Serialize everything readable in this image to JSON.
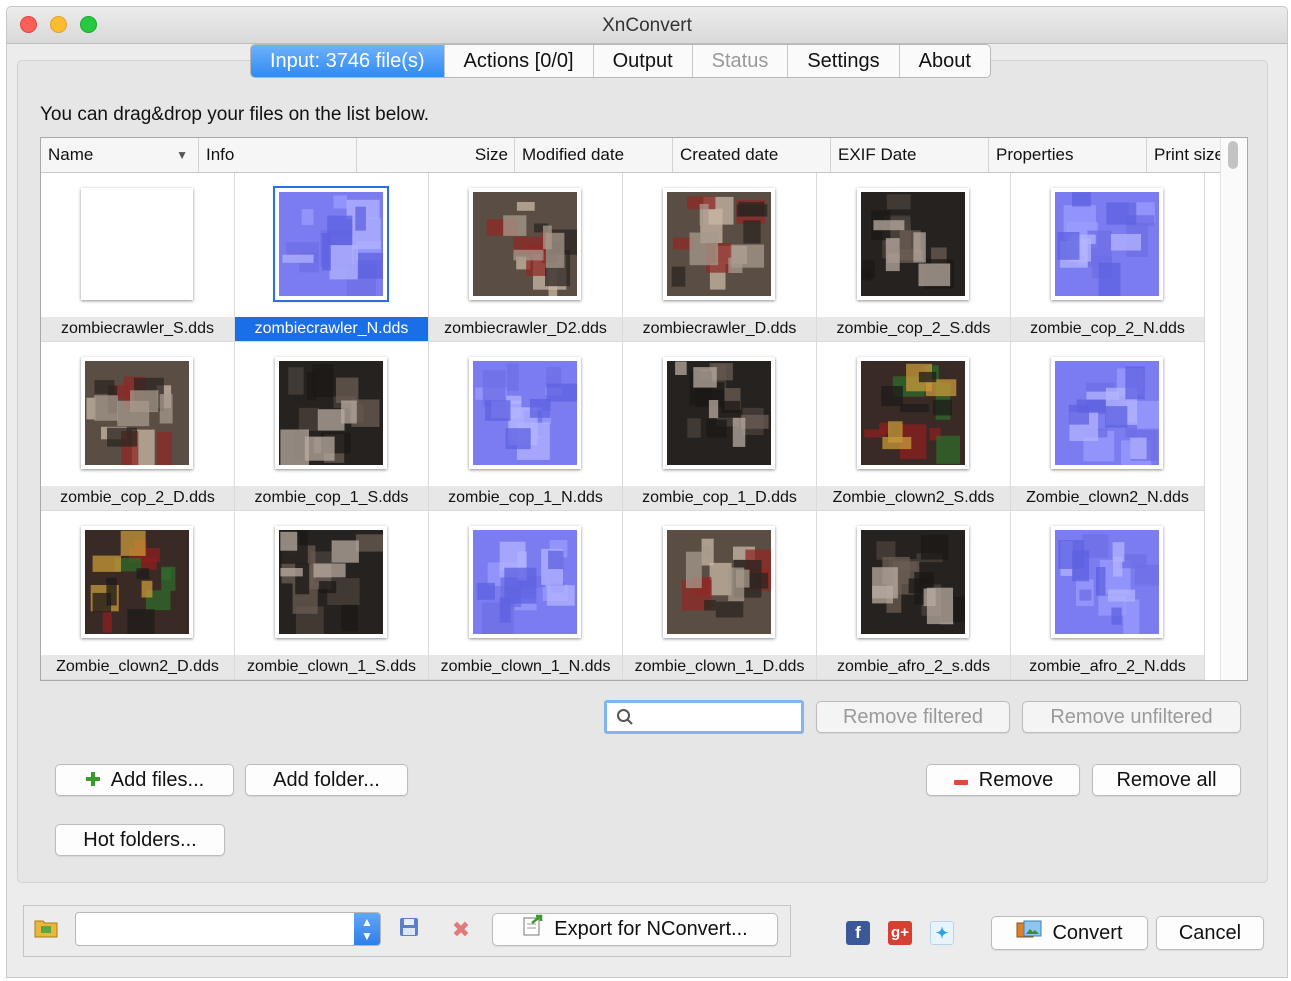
{
  "window": {
    "title": "XnConvert"
  },
  "tabs": [
    {
      "label": "Input: 3746 file(s)",
      "state": "active"
    },
    {
      "label": "Actions [0/0]",
      "state": "normal"
    },
    {
      "label": "Output",
      "state": "normal"
    },
    {
      "label": "Status",
      "state": "disabled"
    },
    {
      "label": "Settings",
      "state": "normal"
    },
    {
      "label": "About",
      "state": "normal"
    }
  ],
  "input": {
    "hint": "You can drag&drop your files on the list below.",
    "columns": [
      {
        "label": "Name",
        "sort_icon": "sort-down-icon"
      },
      {
        "label": "Info"
      },
      {
        "label": "Size"
      },
      {
        "label": "Modified date"
      },
      {
        "label": "Created date"
      },
      {
        "label": "EXIF Date"
      },
      {
        "label": "Properties"
      },
      {
        "label": "Print size"
      }
    ],
    "files": [
      {
        "name": "zombiecrawler_S.dds",
        "kind": "white"
      },
      {
        "name": "zombiecrawler_N.dds",
        "kind": "normal",
        "selected": true
      },
      {
        "name": "zombiecrawler_D2.dds",
        "kind": "diffuse"
      },
      {
        "name": "zombiecrawler_D.dds",
        "kind": "diffuse"
      },
      {
        "name": "zombie_cop_2_S.dds",
        "kind": "dark"
      },
      {
        "name": "zombie_cop_2_N.dds",
        "kind": "normal"
      },
      {
        "name": "zombie_cop_2_D.dds",
        "kind": "diffuse"
      },
      {
        "name": "zombie_cop_1_S.dds",
        "kind": "dark"
      },
      {
        "name": "zombie_cop_1_N.dds",
        "kind": "normal"
      },
      {
        "name": "zombie_cop_1_D.dds",
        "kind": "dark"
      },
      {
        "name": "Zombie_clown2_S.dds",
        "kind": "clown"
      },
      {
        "name": "Zombie_clown2_N.dds",
        "kind": "normal"
      },
      {
        "name": "Zombie_clown2_D.dds",
        "kind": "clown"
      },
      {
        "name": "zombie_clown_1_S.dds",
        "kind": "dark"
      },
      {
        "name": "zombie_clown_1_N.dds",
        "kind": "normal"
      },
      {
        "name": "zombie_clown_1_D.dds",
        "kind": "diffuse"
      },
      {
        "name": "zombie_afro_2_s.dds",
        "kind": "dark"
      },
      {
        "name": "zombie_afro_2_N.dds",
        "kind": "normal"
      }
    ],
    "search": {
      "value": "",
      "placeholder": ""
    },
    "remove_filtered_label": "Remove filtered",
    "remove_unfiltered_label": "Remove unfiltered",
    "add_files_label": "Add files...",
    "add_folder_label": "Add folder...",
    "remove_label": "Remove",
    "remove_all_label": "Remove all",
    "hot_folders_label": "Hot folders..."
  },
  "footer": {
    "preset_value": "",
    "export_label": "Export for NConvert...",
    "convert_label": "Convert",
    "cancel_label": "Cancel"
  },
  "colors": {
    "accent": "#2f8af3",
    "selection": "#1a6ee8",
    "normal_map": "#7b7cf0",
    "remove_icon": "#e0463c",
    "add_icon": "#3b9a2e"
  }
}
